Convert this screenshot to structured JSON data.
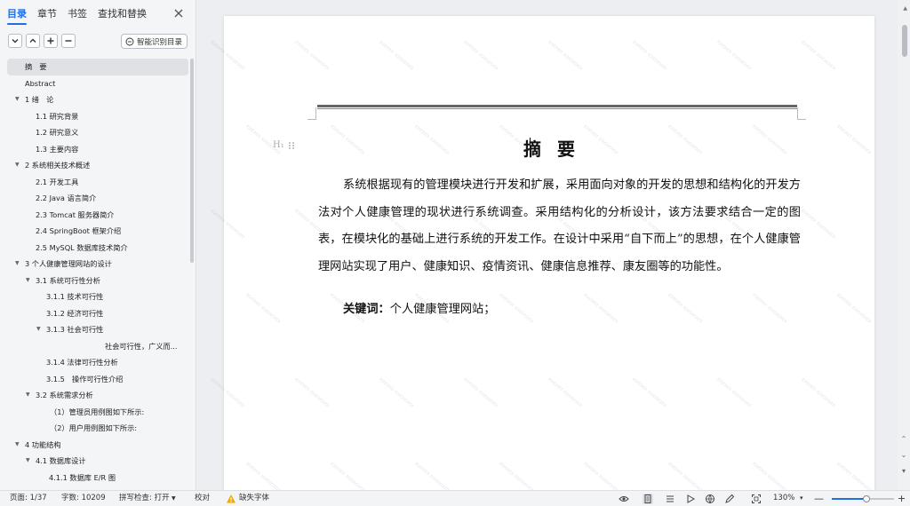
{
  "sidebar": {
    "tabs": [
      "目录",
      "章节",
      "书签",
      "查找和替换"
    ],
    "active_tab": 0,
    "smart_toc_label": "智能识别目录",
    "toc": [
      {
        "label": "摘　要",
        "indent": 28,
        "arrow": false,
        "selected": true
      },
      {
        "label": "Abstract",
        "indent": 28,
        "arrow": false
      },
      {
        "label": "1  绪　论",
        "indent": 28,
        "arrow": true
      },
      {
        "label": "1.1  研究背景",
        "indent": 40,
        "arrow": false
      },
      {
        "label": "1.2  研究意义",
        "indent": 40,
        "arrow": false
      },
      {
        "label": "1.3  主要内容",
        "indent": 40,
        "arrow": false
      },
      {
        "label": "2 系统相关技术概述",
        "indent": 28,
        "arrow": true
      },
      {
        "label": "2.1 开发工具",
        "indent": 40,
        "arrow": false
      },
      {
        "label": "2.2 Java 语言简介",
        "indent": 40,
        "arrow": false
      },
      {
        "label": "2.3 Tomcat 服务器简介",
        "indent": 40,
        "arrow": false
      },
      {
        "label": "2.4 SpringBoot 框架介绍",
        "indent": 40,
        "arrow": false
      },
      {
        "label": "2.5 MySQL 数据库技术简介",
        "indent": 40,
        "arrow": false
      },
      {
        "label": "3  个人健康管理网站的设计",
        "indent": 28,
        "arrow": true
      },
      {
        "label": "3.1 系统可行性分析",
        "indent": 40,
        "arrow": true
      },
      {
        "label": "3.1.1 技术可行性",
        "indent": 52,
        "arrow": false
      },
      {
        "label": "3.1.2 经济可行性",
        "indent": 52,
        "arrow": false
      },
      {
        "label": "3.1.3 社会可行性",
        "indent": 52,
        "arrow": true
      },
      {
        "label": "社会可行性，广义而...",
        "indent": 118,
        "arrow": false
      },
      {
        "label": "3.1.4 法律可行性分析",
        "indent": 52,
        "arrow": false
      },
      {
        "label": "3.1.5　操作可行性介绍",
        "indent": 52,
        "arrow": false
      },
      {
        "label": "3.2  系统需求分析",
        "indent": 40,
        "arrow": true
      },
      {
        "label": "（1）管理员用例图如下所示:",
        "indent": 56,
        "arrow": false
      },
      {
        "label": "（2）用户用例图如下所示:",
        "indent": 56,
        "arrow": false
      },
      {
        "label": "4 功能结构",
        "indent": 28,
        "arrow": true
      },
      {
        "label": "4.1  数据库设计",
        "indent": 40,
        "arrow": true
      },
      {
        "label": "4.1.1  数据库 E/R 图",
        "indent": 55,
        "arrow": false
      }
    ]
  },
  "document": {
    "heading_marker": "H₁",
    "title": "摘要",
    "body": "系统根据现有的管理模块进行开发和扩展，采用面向对象的开发的思想和结构化的开发方法对个人健康管理的现状进行系统调查。采用结构化的分析设计，该方法要求结合一定的图表，在模块化的基础上进行系统的开发工作。在设计中采用“自下而上”的思想，在个人健康管理网站实现了用户、健康知识、疫情资讯、健康信息推荐、康友圈等的功能性。",
    "keywords_label": "关键词：",
    "keywords_value": "个人健康管理网站；"
  },
  "statusbar": {
    "page": "页面: 1/37",
    "words": "字数: 10209",
    "spell": "拼写检查: 打开",
    "proof": "校对",
    "missing_font": "缺失字体",
    "zoom": "130%",
    "zoom_level": 0.55
  },
  "colors": {
    "accent": "#1f6fe0",
    "warning": "#f2a900"
  }
}
